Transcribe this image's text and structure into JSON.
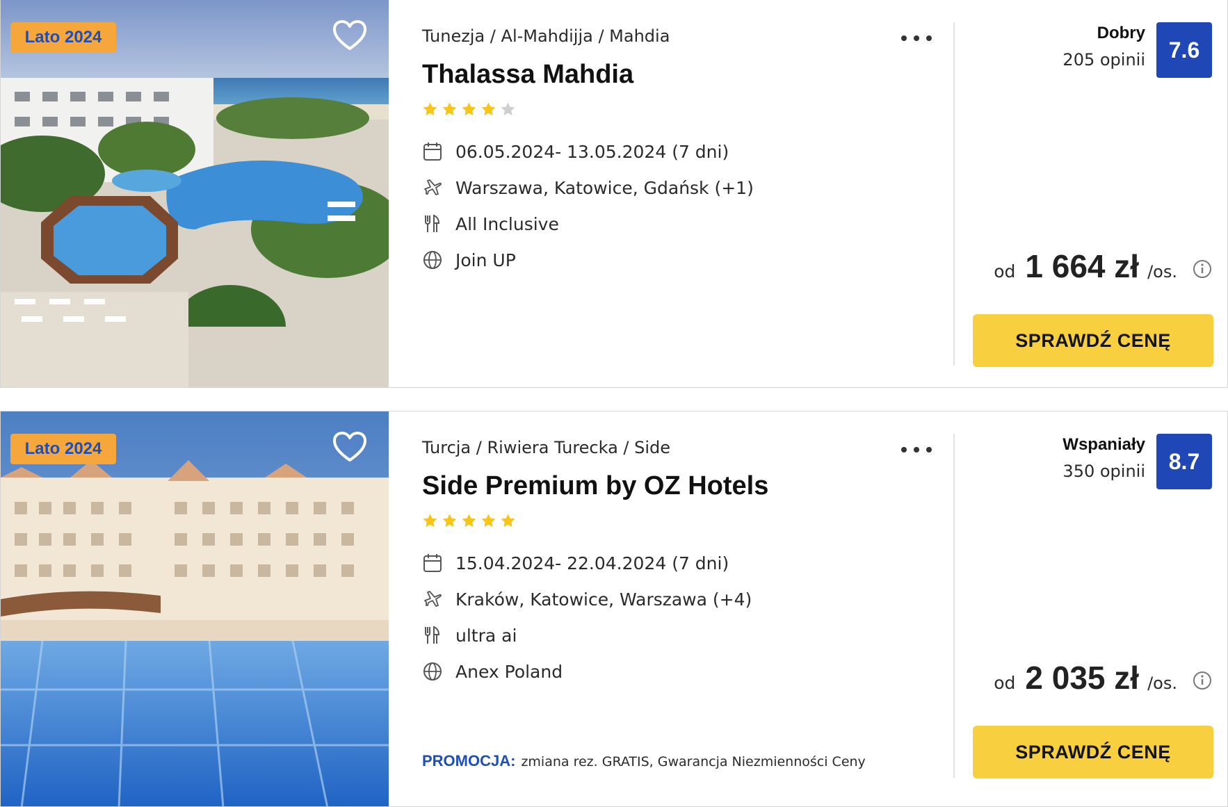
{
  "offers": [
    {
      "badge": "Lato 2024",
      "breadcrumb": "Tunezja / Al-Mahdijja / Mahdia",
      "name": "Thalassa Mahdia",
      "stars": 4,
      "stars_max": 5,
      "dates": "06.05.2024- 13.05.2024  (7 dni)",
      "departures": "Warszawa, Katowice, Gdańsk  (+1)",
      "board": "All Inclusive",
      "operator": "Join UP",
      "rating_word": "Dobry",
      "rating_count": "205 opinii",
      "score": "7.6",
      "price_from": "od",
      "price_value": "1 664 zł",
      "price_unit": "/os.",
      "cta": "SPRAWDŹ CENĘ"
    },
    {
      "badge": "Lato 2024",
      "breadcrumb": "Turcja / Riwiera Turecka / Side",
      "name": "Side Premium by OZ Hotels",
      "stars": 5,
      "stars_max": 5,
      "dates": "15.04.2024- 22.04.2024  (7 dni)",
      "departures": "Kraków, Katowice, Warszawa  (+4)",
      "board": "ultra ai",
      "operator": "Anex Poland",
      "promo_label": "PROMOCJA:",
      "promo_text": "zmiana rez. GRATIS, Gwarancja Niezmienności Ceny",
      "rating_word": "Wspaniały",
      "rating_count": "350 opinii",
      "score": "8.7",
      "price_from": "od",
      "price_value": "2 035 zł",
      "price_unit": "/os.",
      "cta": "SPRAWDŹ CENĘ"
    }
  ],
  "icons": {
    "favorite": "heart-outline-icon",
    "more": "more-dots-icon",
    "dates": "calendar-icon",
    "departures": "plane-icon",
    "board": "cutlery-icon",
    "operator": "globe-icon",
    "price_info": "info-icon",
    "star": "star-icon"
  },
  "colors": {
    "badge_bg": "#f5a73b",
    "badge_text": "#1e4fb8",
    "score_bg": "#1f48b6",
    "cta_bg": "#f8cf3f",
    "star_on": "#f7c518",
    "star_off": "#cfcfcf",
    "promo": "#1e4fb8"
  }
}
